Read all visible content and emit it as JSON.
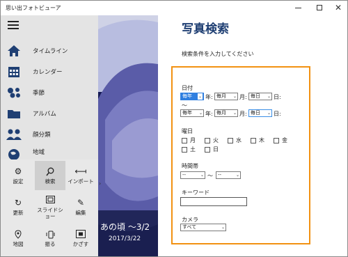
{
  "window": {
    "title": "思い出フォトビューア",
    "close_glyph": "✕"
  },
  "nav": {
    "items": [
      {
        "label": "タイムライン",
        "icon": "home-icon"
      },
      {
        "label": "カレンダー",
        "icon": "calendar-icon"
      },
      {
        "label": "季節",
        "icon": "flower-icon"
      },
      {
        "label": "アルバム",
        "icon": "folder-icon"
      },
      {
        "label": "顔分類",
        "icon": "people-icon"
      },
      {
        "label": "地域",
        "icon": "globe-icon"
      }
    ]
  },
  "commands": [
    {
      "label": "設定",
      "icon": "gear-icon"
    },
    {
      "label": "検索",
      "icon": "search-icon",
      "active": true
    },
    {
      "label": "インポート",
      "icon": "import-icon"
    },
    {
      "label": "更新",
      "icon": "refresh-icon"
    },
    {
      "label": "スライドショー",
      "icon": "slideshow-icon"
    },
    {
      "label": "編集",
      "icon": "edit-icon"
    },
    {
      "label": "地図",
      "icon": "map-icon"
    },
    {
      "label": "振る",
      "icon": "shake-icon"
    },
    {
      "label": "かざす",
      "icon": "hold-icon"
    }
  ],
  "photo": {
    "caption_title": "あの頃 〜3/2",
    "caption_date": "2017/3/22",
    "expand_glyph": "›"
  },
  "search": {
    "title": "写真検索",
    "subtitle": "検索条件を入力してください",
    "date_label": "日付",
    "from": {
      "year": "毎年",
      "month": "毎月",
      "day": "毎日"
    },
    "tilde": "〜",
    "to": {
      "year": "毎年",
      "month": "毎月",
      "day": "毎日"
    },
    "unit_year": "年:",
    "unit_month": "月:",
    "unit_day": "日:",
    "weekday_label": "曜日",
    "weekdays": [
      "月",
      "火",
      "水",
      "木",
      "金",
      "土",
      "日"
    ],
    "time_label": "時間帯",
    "time_from": "--",
    "time_to": "--",
    "time_tilde": "〜",
    "keyword_label": "キーワード",
    "keyword_value": "",
    "camera_label": "カメラ",
    "camera_value": "すべて"
  },
  "colors": {
    "highlight_box": "#f29111",
    "title": "#1f3f73",
    "photo_background": "#151a55"
  }
}
